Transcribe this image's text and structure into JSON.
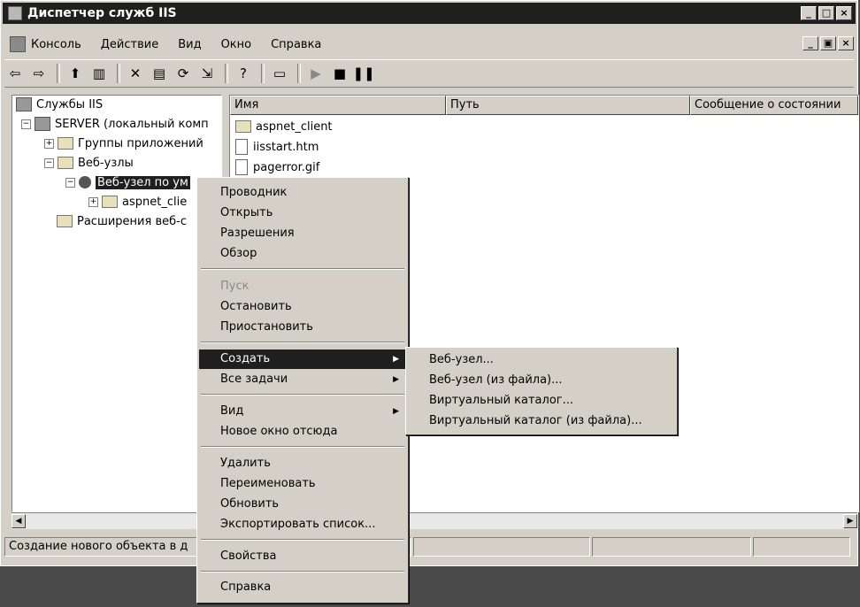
{
  "window": {
    "title": "Диспетчер служб IIS"
  },
  "menubar": {
    "items": [
      "Консоль",
      "Действие",
      "Вид",
      "Окно",
      "Справка"
    ]
  },
  "tree": {
    "root": "Службы IIS",
    "server": "SERVER (локальный комп",
    "app_groups": "Группы приложений",
    "websites": "Веб-узлы",
    "default_site": "Веб-узел по ум",
    "aspnet_client": "aspnet_clie",
    "extensions": "Расширения веб-с"
  },
  "list": {
    "columns": [
      "Имя",
      "Путь",
      "Сообщение о состоянии"
    ],
    "rows": [
      "aspnet_client",
      "iisstart.htm",
      "pagerror.gif"
    ]
  },
  "context_menu": {
    "items": [
      "Проводник",
      "Открыть",
      "Разрешения",
      "Обзор",
      "Пуск",
      "Остановить",
      "Приостановить",
      "Создать",
      "Все задачи",
      "Вид",
      "Новое окно отсюда",
      "Удалить",
      "Переименовать",
      "Обновить",
      "Экспортировать список...",
      "Свойства",
      "Справка"
    ]
  },
  "submenu": {
    "items": [
      "Веб-узел...",
      "Веб-узел (из файла)...",
      "Виртуальный каталог...",
      "Виртуальный каталог (из файла)..."
    ]
  },
  "statusbar": {
    "text": "Создание нового объекта в д"
  }
}
